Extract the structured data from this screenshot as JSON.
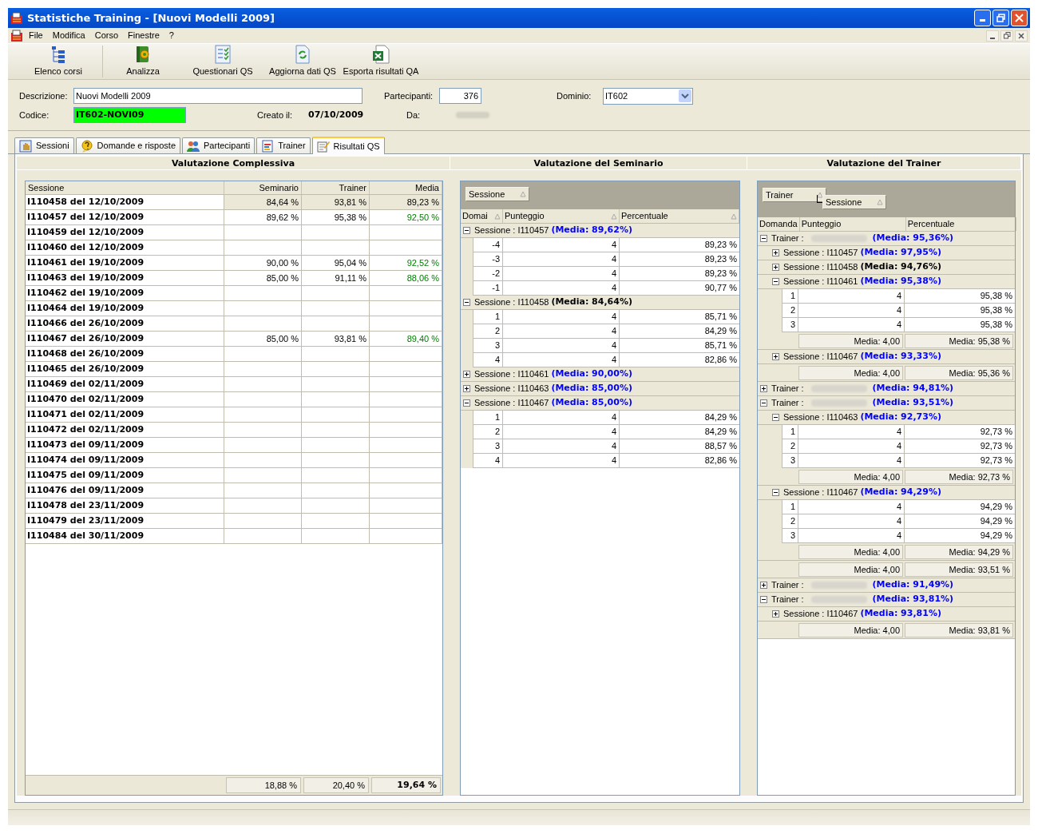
{
  "window": {
    "title": "Statistiche Training - [Nuovi Modelli 2009]"
  },
  "menu": [
    "File",
    "Modifica",
    "Corso",
    "Finestre",
    "?"
  ],
  "toolbar": [
    "Elenco corsi",
    "Analizza",
    "Questionari QS",
    "Aggiorna dati QS",
    "Esporta risultati QA"
  ],
  "form": {
    "descrizione_label": "Descrizione:",
    "descrizione": "Nuovi Modelli 2009",
    "partecipanti_label": "Partecipanti:",
    "partecipanti": "376",
    "dominio_label": "Dominio:",
    "dominio": "IT602",
    "codice_label": "Codice:",
    "codice": "IT602-NOVI09",
    "creato_label": "Creato il:",
    "creato": "07/10/2009",
    "da_label": "Da:"
  },
  "tabs": [
    {
      "label": "Sessioni",
      "selected": false
    },
    {
      "label": "Domande e risposte",
      "selected": false
    },
    {
      "label": "Partecipanti",
      "selected": false
    },
    {
      "label": "Trainer",
      "selected": false
    },
    {
      "label": "Risultati QS",
      "selected": true
    }
  ],
  "sections": [
    "Valutazione Complessiva",
    "Valutazione del Seminario",
    "Valutazione del Trainer"
  ],
  "overall": {
    "columns": [
      "Sessione",
      "Seminario",
      "Trainer",
      "Media"
    ],
    "rows": [
      {
        "sessione": "I110458 del 12/10/2009",
        "seminario": "84,64 %",
        "trainer": "93,81 %",
        "media": "89,23 %",
        "selected": true
      },
      {
        "sessione": "I110457 del 12/10/2009",
        "seminario": "89,62 %",
        "trainer": "95,38 %",
        "media": "92,50 %",
        "selected": false
      },
      {
        "sessione": "I110459 del 12/10/2009",
        "selected": false
      },
      {
        "sessione": "I110460 del 12/10/2009",
        "selected": false
      },
      {
        "sessione": "I110461 del 19/10/2009",
        "seminario": "90,00 %",
        "trainer": "95,04 %",
        "media": "92,52 %",
        "selected": false
      },
      {
        "sessione": "I110463 del 19/10/2009",
        "seminario": "85,00 %",
        "trainer": "91,11 %",
        "media": "88,06 %",
        "selected": false
      },
      {
        "sessione": "I110462 del 19/10/2009",
        "selected": false
      },
      {
        "sessione": "I110464 del 19/10/2009",
        "selected": false
      },
      {
        "sessione": "I110466 del 26/10/2009",
        "selected": false
      },
      {
        "sessione": "I110467 del 26/10/2009",
        "seminario": "85,00 %",
        "trainer": "93,81 %",
        "media": "89,40 %",
        "selected": false
      },
      {
        "sessione": "I110468 del 26/10/2009",
        "selected": false
      },
      {
        "sessione": "I110465 del 26/10/2009",
        "selected": false
      },
      {
        "sessione": "I110469 del 02/11/2009",
        "selected": false
      },
      {
        "sessione": "I110470 del 02/11/2009",
        "selected": false
      },
      {
        "sessione": "I110471 del 02/11/2009",
        "selected": false
      },
      {
        "sessione": "I110472 del 02/11/2009",
        "selected": false
      },
      {
        "sessione": "I110473 del 09/11/2009",
        "selected": false
      },
      {
        "sessione": "I110474 del 09/11/2009",
        "selected": false
      },
      {
        "sessione": "I110475 del 09/11/2009",
        "selected": false
      },
      {
        "sessione": "I110476 del 09/11/2009",
        "selected": false
      },
      {
        "sessione": "I110478 del 23/11/2009",
        "selected": false
      },
      {
        "sessione": "I110479 del 23/11/2009",
        "selected": false
      },
      {
        "sessione": "I110484 del 30/11/2009",
        "selected": false
      }
    ],
    "totals": [
      "18,88 %",
      "20,40 %",
      "19,64 %"
    ]
  },
  "seminar": {
    "group_by": [
      "Sessione"
    ],
    "columns": [
      "Domai",
      "Punteggio",
      "Percentuale"
    ],
    "groups": [
      {
        "label": "Sessione : I110457",
        "media": "(Media: 89,62%)",
        "expanded": true,
        "selected": false,
        "rows": [
          [
            "-4",
            "4",
            "89,23 %"
          ],
          [
            "-3",
            "4",
            "89,23 %"
          ],
          [
            "-2",
            "4",
            "89,23 %"
          ],
          [
            "-1",
            "4",
            "90,77 %"
          ]
        ]
      },
      {
        "label": "Sessione : I110458",
        "media": "(Media: 84,64%)",
        "expanded": true,
        "selected": true,
        "rows": [
          [
            "1",
            "4",
            "85,71 %"
          ],
          [
            "2",
            "4",
            "84,29 %"
          ],
          [
            "3",
            "4",
            "85,71 %"
          ],
          [
            "4",
            "4",
            "82,86 %"
          ]
        ]
      },
      {
        "label": "Sessione : I110461",
        "media": "(Media: 90,00%)",
        "expanded": false,
        "selected": false
      },
      {
        "label": "Sessione : I110463",
        "media": "(Media: 85,00%)",
        "expanded": false,
        "selected": false
      },
      {
        "label": "Sessione : I110467",
        "media": "(Media: 85,00%)",
        "expanded": true,
        "selected": false,
        "rows": [
          [
            "1",
            "4",
            "84,29 %"
          ],
          [
            "2",
            "4",
            "84,29 %"
          ],
          [
            "3",
            "4",
            "88,57 %"
          ],
          [
            "4",
            "4",
            "82,86 %"
          ]
        ]
      }
    ]
  },
  "trainer": {
    "group_by": [
      "Trainer",
      "Sessione"
    ],
    "columns": [
      "Domanda",
      "Punteggio",
      "Percentuale"
    ],
    "groups": [
      {
        "label": "Trainer :",
        "media": "(Media: 95,36%)",
        "expanded": true,
        "selected": false,
        "summary": [
          "Media: 4,00",
          "Media: 95,36 %"
        ],
        "children": [
          {
            "label": "Sessione : I110457",
            "media": "(Media: 97,95%)",
            "expanded": false,
            "selected": false
          },
          {
            "label": "Sessione : I110458",
            "media": "(Media: 94,76%)",
            "expanded": false,
            "selected": true
          },
          {
            "label": "Sessione : I110461",
            "media": "(Media: 95,38%)",
            "expanded": true,
            "selected": false,
            "rows": [
              [
                "1",
                "4",
                "95,38 %"
              ],
              [
                "2",
                "4",
                "95,38 %"
              ],
              [
                "3",
                "4",
                "95,38 %"
              ]
            ],
            "summary": [
              "Media: 4,00",
              "Media: 95,38 %"
            ]
          },
          {
            "label": "Sessione : I110467",
            "media": "(Media: 93,33%)",
            "expanded": false,
            "selected": false
          }
        ]
      },
      {
        "label": "Trainer :",
        "media": "(Media: 94,81%)",
        "expanded": false,
        "selected": false
      },
      {
        "label": "Trainer :",
        "media": "(Media: 93,51%)",
        "expanded": true,
        "selected": false,
        "summary": [
          "Media: 4,00",
          "Media: 93,51 %"
        ],
        "children": [
          {
            "label": "Sessione : I110463",
            "media": "(Media: 92,73%)",
            "expanded": true,
            "selected": false,
            "rows": [
              [
                "1",
                "4",
                "92,73 %"
              ],
              [
                "2",
                "4",
                "92,73 %"
              ],
              [
                "3",
                "4",
                "92,73 %"
              ]
            ],
            "summary": [
              "Media: 4,00",
              "Media: 92,73 %"
            ]
          },
          {
            "label": "Sessione : I110467",
            "media": "(Media: 94,29%)",
            "expanded": true,
            "selected": false,
            "rows": [
              [
                "1",
                "4",
                "94,29 %"
              ],
              [
                "2",
                "4",
                "94,29 %"
              ],
              [
                "3",
                "4",
                "94,29 %"
              ]
            ],
            "summary": [
              "Media: 4,00",
              "Media: 94,29 %"
            ]
          }
        ]
      },
      {
        "label": "Trainer :",
        "media": "(Media: 91,49%)",
        "expanded": false,
        "selected": false
      },
      {
        "label": "Trainer :",
        "media": "(Media: 93,81%)",
        "expanded": true,
        "selected": false,
        "summary": [
          "Media: 4,00",
          "Media: 93,81 %"
        ],
        "children": [
          {
            "label": "Sessione : I110467",
            "media": "(Media: 93,81%)",
            "expanded": false,
            "selected": false
          }
        ]
      }
    ]
  }
}
